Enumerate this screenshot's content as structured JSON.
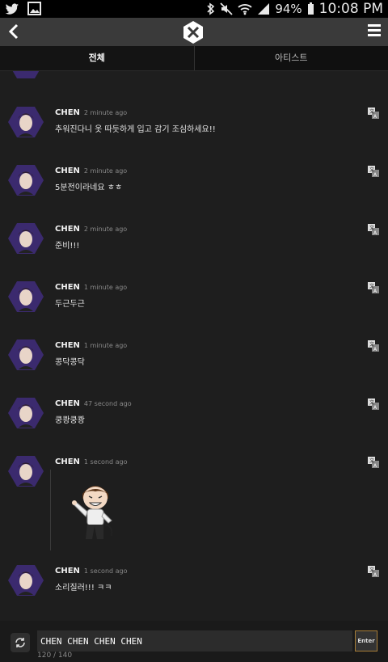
{
  "status_bar": {
    "battery": "94%",
    "time": "10:08 PM"
  },
  "tabs": [
    {
      "label": "전체"
    },
    {
      "label": "아티스트"
    }
  ],
  "messages": [
    {
      "name": "CHEN",
      "time": "2 minute ago",
      "text": "추워진다니 옷 따듯하게 입고 감기 조심하세요!!"
    },
    {
      "name": "CHEN",
      "time": "2 minute ago",
      "text": "5분전이라네요 ㅎㅎ"
    },
    {
      "name": "CHEN",
      "time": "2 minute ago",
      "text": "준비!!!"
    },
    {
      "name": "CHEN",
      "time": "1 minute ago",
      "text": "두근두근"
    },
    {
      "name": "CHEN",
      "time": "1 minute ago",
      "text": "콩닥콩닥"
    },
    {
      "name": "CHEN",
      "time": "47 second ago",
      "text": "쿵쾅쿵쾅"
    },
    {
      "name": "CHEN",
      "time": "1 second ago",
      "text": ""
    },
    {
      "name": "CHEN",
      "time": "1 second ago",
      "text": "소리질러!!! ㅋㅋ"
    }
  ],
  "input": {
    "value": "CHEN CHEN CHEN CHEN",
    "enter_label": "Enter",
    "counter": "120 / 140"
  },
  "colors": {
    "accent": "#a67c36",
    "avatar_bg": "#3b2a6e"
  }
}
